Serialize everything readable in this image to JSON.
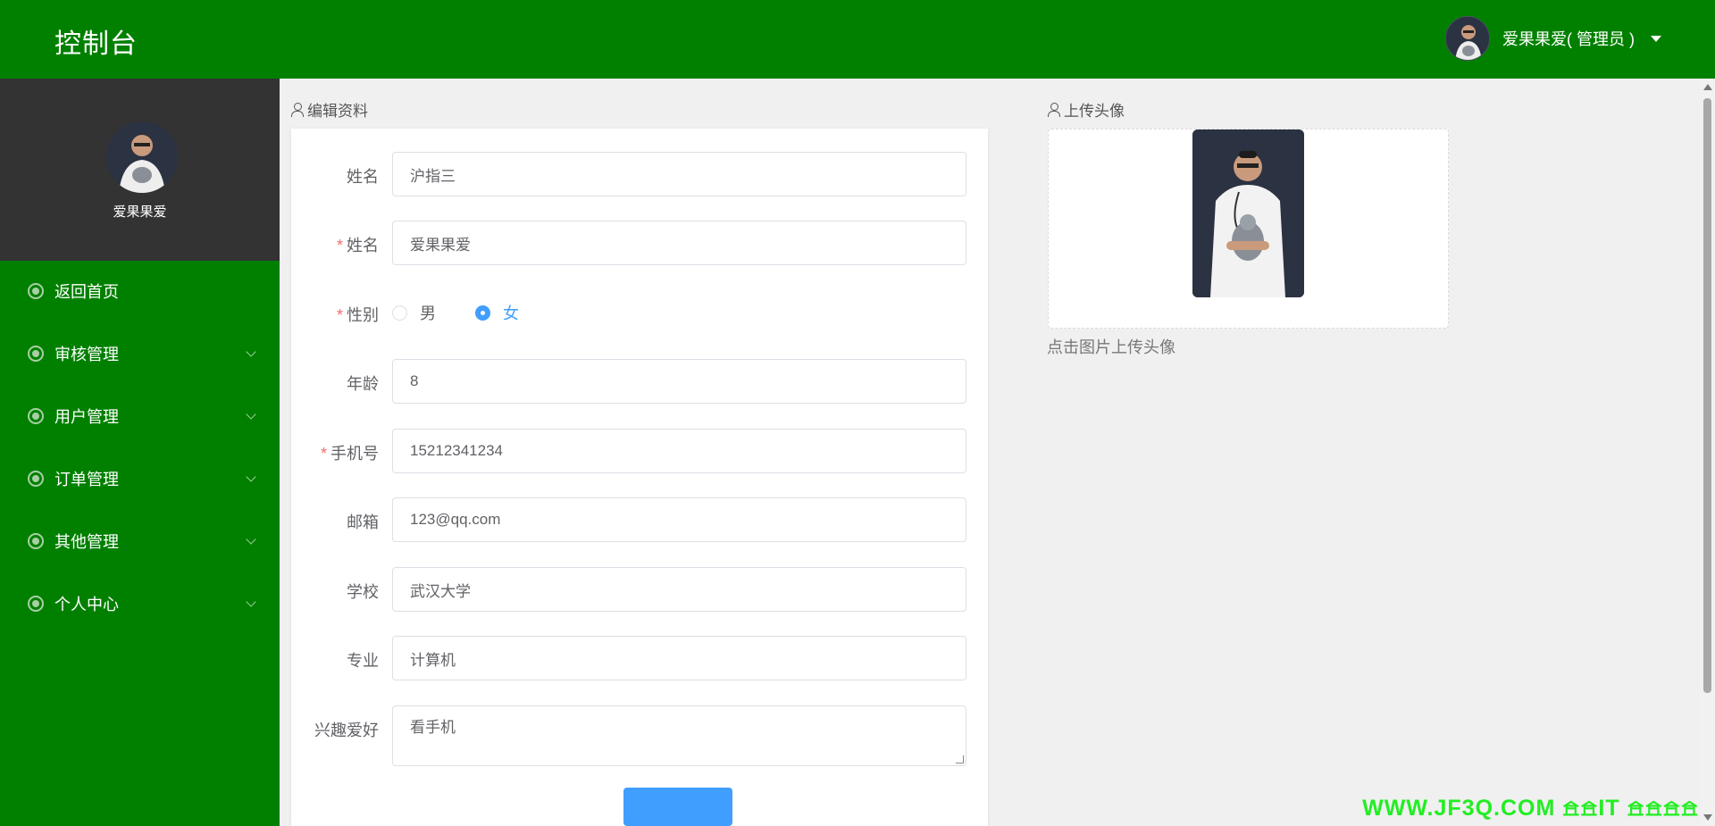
{
  "header": {
    "title": "控制台",
    "user_label": "爱果果爱( 管理员 )"
  },
  "sidebar": {
    "profile_name": "爱果果爱",
    "items": [
      {
        "label": "返回首页"
      },
      {
        "label": "审核管理"
      },
      {
        "label": "用户管理"
      },
      {
        "label": "订单管理"
      },
      {
        "label": "其他管理"
      },
      {
        "label": "个人中心"
      }
    ]
  },
  "edit_profile": {
    "section_title": "编辑资料",
    "fields": {
      "username": {
        "label": "姓名",
        "value": "沪指三"
      },
      "name": {
        "label": "姓名",
        "value": "爱果果爱"
      },
      "gender": {
        "label": "性别",
        "options": [
          "男",
          "女"
        ],
        "selected": "女"
      },
      "age": {
        "label": "年龄",
        "value": "8"
      },
      "phone": {
        "label": "手机号",
        "value": "15212341234"
      },
      "email": {
        "label": "邮箱",
        "value": "123@qq.com"
      },
      "school": {
        "label": "学校",
        "value": "武汉大学"
      },
      "major": {
        "label": "专业",
        "value": "计算机"
      },
      "hobby": {
        "label": "兴趣爱好",
        "value": "看手机"
      }
    }
  },
  "avatar_upload": {
    "section_title": "上传头像",
    "hint": "点击图片上传头像"
  },
  "watermark": "WWW.JF3Q.COM 𖠿𖠿IT 𖠿𖠿𖠿𖠿",
  "colors": {
    "header_bg": "#018000",
    "sidebar_bg": "#018000",
    "profile_bg": "#333333",
    "accent": "#409eff",
    "required": "#f56c6c"
  }
}
